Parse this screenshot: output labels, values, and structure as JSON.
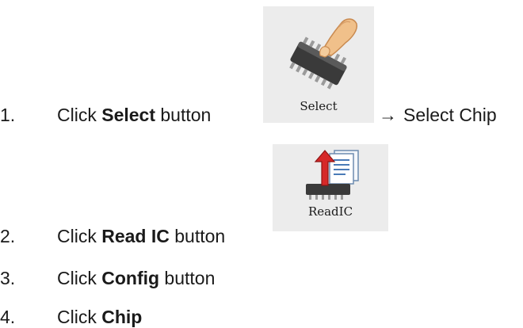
{
  "steps": [
    {
      "number": "1.",
      "prefix": "Click ",
      "bold": "Select",
      "suffix": " button"
    },
    {
      "number": "2.",
      "prefix": "Click ",
      "bold": "Read IC",
      "suffix": " button"
    },
    {
      "number": "3.",
      "prefix": "Click ",
      "bold": "Config",
      "suffix": " button"
    },
    {
      "number": "4.",
      "prefix": "Click ",
      "bold": "Chip",
      "suffix": ""
    }
  ],
  "select_button": {
    "label": "Select",
    "icon": "hand-chip-icon"
  },
  "readic_button": {
    "label": "ReadIC",
    "icon": "read-chip-icon"
  },
  "step1_after": {
    "arrow": "→",
    "text": "Select Chip"
  }
}
